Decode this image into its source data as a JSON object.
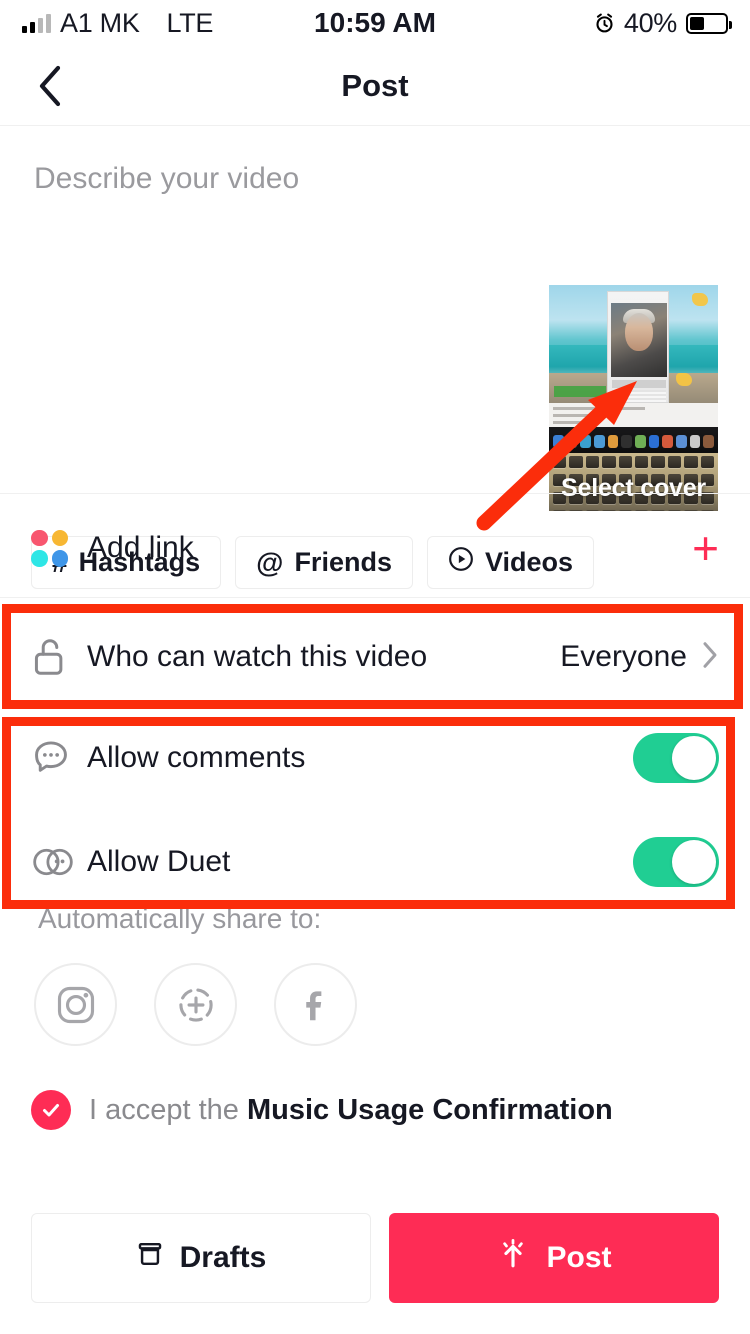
{
  "status_bar": {
    "carrier": "A1 MK",
    "network": "LTE",
    "time": "10:59 AM",
    "battery_percent": "40%",
    "alarm_icon": "alarm-icon",
    "signal_icon": "signal-bars-icon",
    "battery_icon": "battery-icon"
  },
  "nav": {
    "back_icon": "chevron-left-icon",
    "title": "Post"
  },
  "compose": {
    "description_value": "",
    "description_placeholder": "Describe your video",
    "cover": {
      "label": "Select cover"
    },
    "chips": [
      {
        "icon": "hashtag-icon",
        "glyph": "#",
        "label": "Hashtags"
      },
      {
        "icon": "at-mention-icon",
        "glyph": "@",
        "label": "Friends"
      },
      {
        "icon": "play-circle-icon",
        "glyph": "▶",
        "label": "Videos"
      }
    ]
  },
  "options": {
    "add_link": {
      "icon": "four-dots-icon",
      "label": "Add link",
      "action_icon": "plus-icon",
      "action_glyph": "+",
      "dot_colors": [
        "#f8566f",
        "#f7b733",
        "#2ee6e6",
        "#3f96e8"
      ],
      "plus_color": "#fe2c55"
    },
    "privacy": {
      "icon": "unlock-icon",
      "label": "Who can watch this video",
      "value": "Everyone",
      "chevron_icon": "chevron-right-icon"
    },
    "comments": {
      "icon": "comment-bubble-icon",
      "label": "Allow comments",
      "toggle_state": "on",
      "toggle_color": "#20ce93"
    },
    "duet": {
      "icon": "duet-icon",
      "label": "Allow Duet",
      "toggle_state": "on",
      "toggle_color": "#20ce93"
    }
  },
  "share": {
    "label": "Automatically share to:",
    "targets": [
      {
        "icon": "instagram-icon",
        "name": "Instagram"
      },
      {
        "icon": "instagram-story-icon",
        "name": "Instagram Story"
      },
      {
        "icon": "facebook-icon",
        "name": "Facebook"
      }
    ]
  },
  "music_consent": {
    "checked": true,
    "check_icon": "check-circle-icon",
    "prefix": "I accept the ",
    "link_text": "Music Usage Confirmation",
    "accent_color": "#fe2c55"
  },
  "footer": {
    "drafts": {
      "icon": "drafts-archive-icon",
      "label": "Drafts"
    },
    "post": {
      "icon": "upload-arrow-icon",
      "label": "Post",
      "color": "#fe2c55"
    }
  },
  "annotations": {
    "color": "#fb2d0b",
    "arrow": {
      "name": "pointer-arrow-to-select-cover"
    },
    "boxes": [
      {
        "name": "highlight-privacy-row"
      },
      {
        "name": "highlight-comments-duet-rows"
      }
    ]
  }
}
